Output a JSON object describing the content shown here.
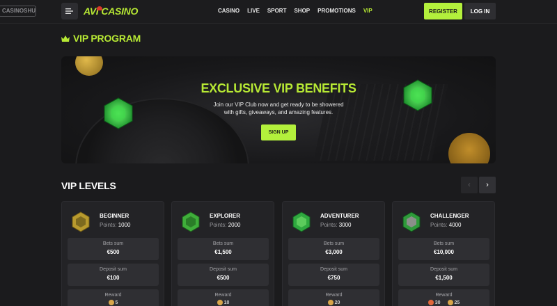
{
  "header": {
    "watermark": "CASINOSHUNTER",
    "logo": {
      "part1": "AVI",
      "part2": "CASINO"
    },
    "nav": [
      "CASINO",
      "LIVE",
      "SPORT",
      "SHOP",
      "PROMOTIONS",
      "VIP"
    ],
    "register_label": "REGISTER",
    "login_label": "LOG IN"
  },
  "vip_section": {
    "title": "VIP PROGRAM"
  },
  "banner": {
    "title": "EXCLUSIVE VIP BENEFITS",
    "text": "Join our VIP Club now and get ready to be showered with gifts, giveaways, and amazing features.",
    "button": "SIGN UP"
  },
  "levels": {
    "title": "VIP LEVELS",
    "points_label": "Points:",
    "bets_label": "Bets sum",
    "deposit_label": "Deposit sum",
    "reward_label": "Reward",
    "cards": [
      {
        "name": "BEGINNER",
        "points": "1000",
        "bets": "€500",
        "deposit": "€100",
        "rewards": [
          "5"
        ]
      },
      {
        "name": "EXPLORER",
        "points": "2000",
        "bets": "€1,500",
        "deposit": "€500",
        "rewards": [
          "10"
        ]
      },
      {
        "name": "ADVENTURER",
        "points": "3000",
        "bets": "€3,000",
        "deposit": "€750",
        "rewards": [
          "20"
        ]
      },
      {
        "name": "CHALLENGER",
        "points": "4000",
        "bets": "€10,000",
        "deposit": "€1,500",
        "rewards": [
          "30",
          "25"
        ]
      }
    ]
  },
  "colors": {
    "accent": "#b7e934",
    "button": "#b3f03c",
    "background": "#1b1b1d",
    "card": "#232326",
    "stat": "#2f2f33"
  }
}
